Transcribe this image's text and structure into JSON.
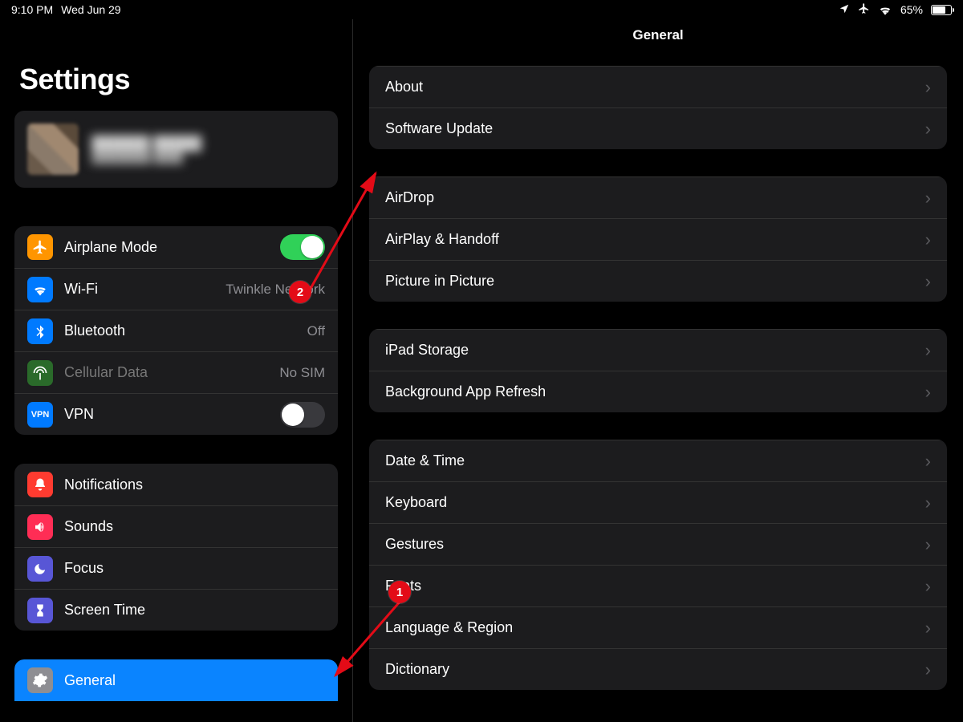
{
  "statusbar": {
    "time": "9:10 PM",
    "date": "Wed Jun 29",
    "battery_pct": "65%",
    "location_icon": "location",
    "airplane_icon": "airplane",
    "wifi_icon": "wifi",
    "battery_icon": "battery"
  },
  "sidebar": {
    "title": "Settings",
    "account": {
      "name": "██████ █████",
      "sub": "████████ ████"
    },
    "group1": {
      "airplane": {
        "label": "Airplane Mode",
        "toggle_on": true
      },
      "wifi": {
        "label": "Wi-Fi",
        "detail": "Twinkle Network"
      },
      "bluetooth": {
        "label": "Bluetooth",
        "detail": "Off"
      },
      "cellular": {
        "label": "Cellular Data",
        "detail": "No SIM"
      },
      "vpn": {
        "label": "VPN",
        "toggle_on": false
      }
    },
    "group2": {
      "notifications": {
        "label": "Notifications"
      },
      "sounds": {
        "label": "Sounds"
      },
      "focus": {
        "label": "Focus"
      },
      "screentime": {
        "label": "Screen Time"
      }
    },
    "group3": {
      "general": {
        "label": "General",
        "selected": true
      }
    }
  },
  "content": {
    "title": "General",
    "g1": {
      "about": "About",
      "software_update": "Software Update"
    },
    "g2": {
      "airdrop": "AirDrop",
      "airplay": "AirPlay & Handoff",
      "pip": "Picture in Picture"
    },
    "g3": {
      "storage": "iPad Storage",
      "bgapp": "Background App Refresh"
    },
    "g4": {
      "datetime": "Date & Time",
      "keyboard": "Keyboard",
      "gestures": "Gestures",
      "fonts": "Fonts",
      "lang": "Language & Region",
      "dict": "Dictionary"
    }
  },
  "annotations": {
    "dot1": "1",
    "dot2": "2"
  }
}
